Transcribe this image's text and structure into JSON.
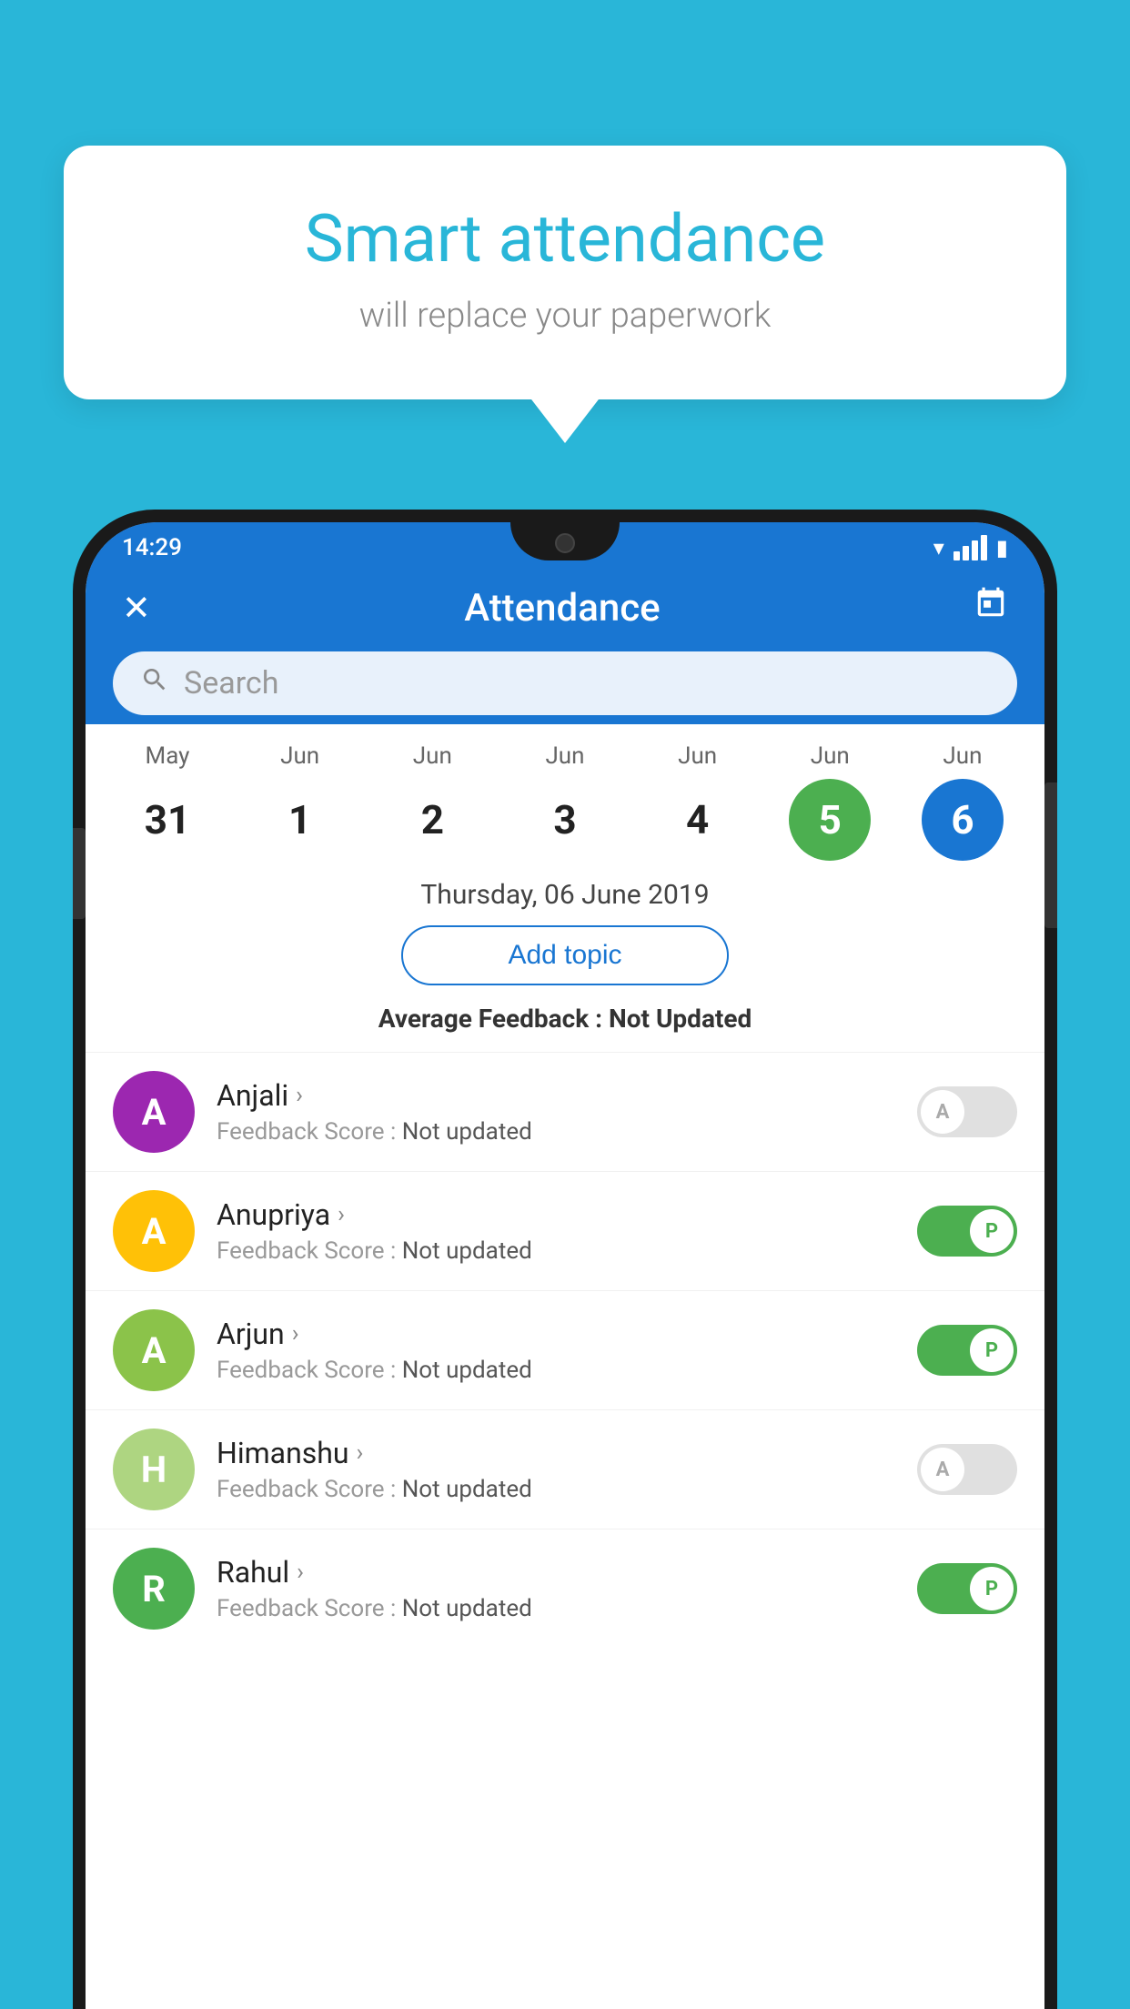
{
  "background": {
    "color": "#29B6D8"
  },
  "speech_bubble": {
    "title": "Smart attendance",
    "subtitle": "will replace your paperwork"
  },
  "status_bar": {
    "time": "14:29",
    "wifi": "▾",
    "signal": "▲",
    "battery": "▮"
  },
  "toolbar": {
    "close_label": "✕",
    "title": "Attendance",
    "calendar_icon": "📅"
  },
  "search": {
    "placeholder": "Search"
  },
  "calendar": {
    "days": [
      {
        "month": "May",
        "date": "31",
        "state": "normal"
      },
      {
        "month": "Jun",
        "date": "1",
        "state": "normal"
      },
      {
        "month": "Jun",
        "date": "2",
        "state": "normal"
      },
      {
        "month": "Jun",
        "date": "3",
        "state": "normal"
      },
      {
        "month": "Jun",
        "date": "4",
        "state": "normal"
      },
      {
        "month": "Jun",
        "date": "5",
        "state": "today"
      },
      {
        "month": "Jun",
        "date": "6",
        "state": "selected"
      }
    ],
    "selected_date_label": "Thursday, 06 June 2019"
  },
  "add_topic_button": "Add topic",
  "average_feedback": {
    "label": "Average Feedback : ",
    "value": "Not Updated"
  },
  "students": [
    {
      "name": "Anjali",
      "avatar_letter": "A",
      "avatar_color": "#9C27B0",
      "feedback": "Feedback Score : Not updated",
      "attendance": "absent"
    },
    {
      "name": "Anupriya",
      "avatar_letter": "A",
      "avatar_color": "#FFC107",
      "feedback": "Feedback Score : Not updated",
      "attendance": "present"
    },
    {
      "name": "Arjun",
      "avatar_letter": "A",
      "avatar_color": "#8BC34A",
      "feedback": "Feedback Score : Not updated",
      "attendance": "present"
    },
    {
      "name": "Himanshu",
      "avatar_letter": "H",
      "avatar_color": "#AED581",
      "feedback": "Feedback Score : Not updated",
      "attendance": "absent"
    },
    {
      "name": "Rahul",
      "avatar_letter": "R",
      "avatar_color": "#4CAF50",
      "feedback": "Feedback Score : Not updated",
      "attendance": "present"
    }
  ]
}
